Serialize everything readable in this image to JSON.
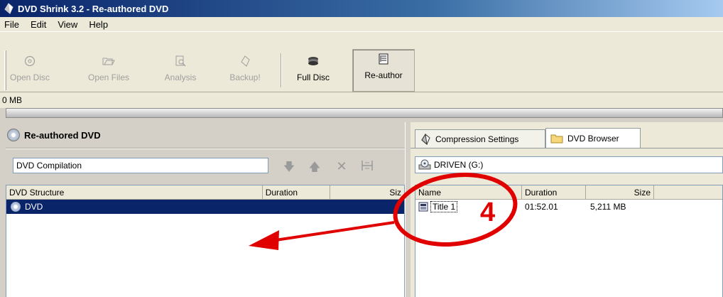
{
  "window": {
    "title": "DVD Shrink 3.2 - Re-authored DVD"
  },
  "menu": {
    "items": [
      "File",
      "Edit",
      "View",
      "Help"
    ]
  },
  "toolbar": {
    "open_disc": "Open Disc",
    "open_files": "Open Files",
    "analysis": "Analysis",
    "backup": "Backup!",
    "full_disc": "Full Disc",
    "re_author": "Re-author"
  },
  "status": {
    "size": "0 MB"
  },
  "left_pane": {
    "header": "Re-authored DVD",
    "compilation_name": "DVD Compilation",
    "columns": [
      "DVD Structure",
      "Duration",
      "Siz"
    ],
    "rows": [
      {
        "name": "DVD"
      }
    ]
  },
  "right_pane": {
    "tabs": [
      "Compression Settings",
      "DVD Browser"
    ],
    "drive": "DRIVEN (G:)",
    "columns": [
      "Name",
      "Duration",
      "Size"
    ],
    "rows": [
      {
        "name": "Title 1",
        "duration": "01:52.01",
        "size": "5,211 MB"
      }
    ]
  },
  "annotation": {
    "number": "4",
    "color": "#e00000"
  }
}
